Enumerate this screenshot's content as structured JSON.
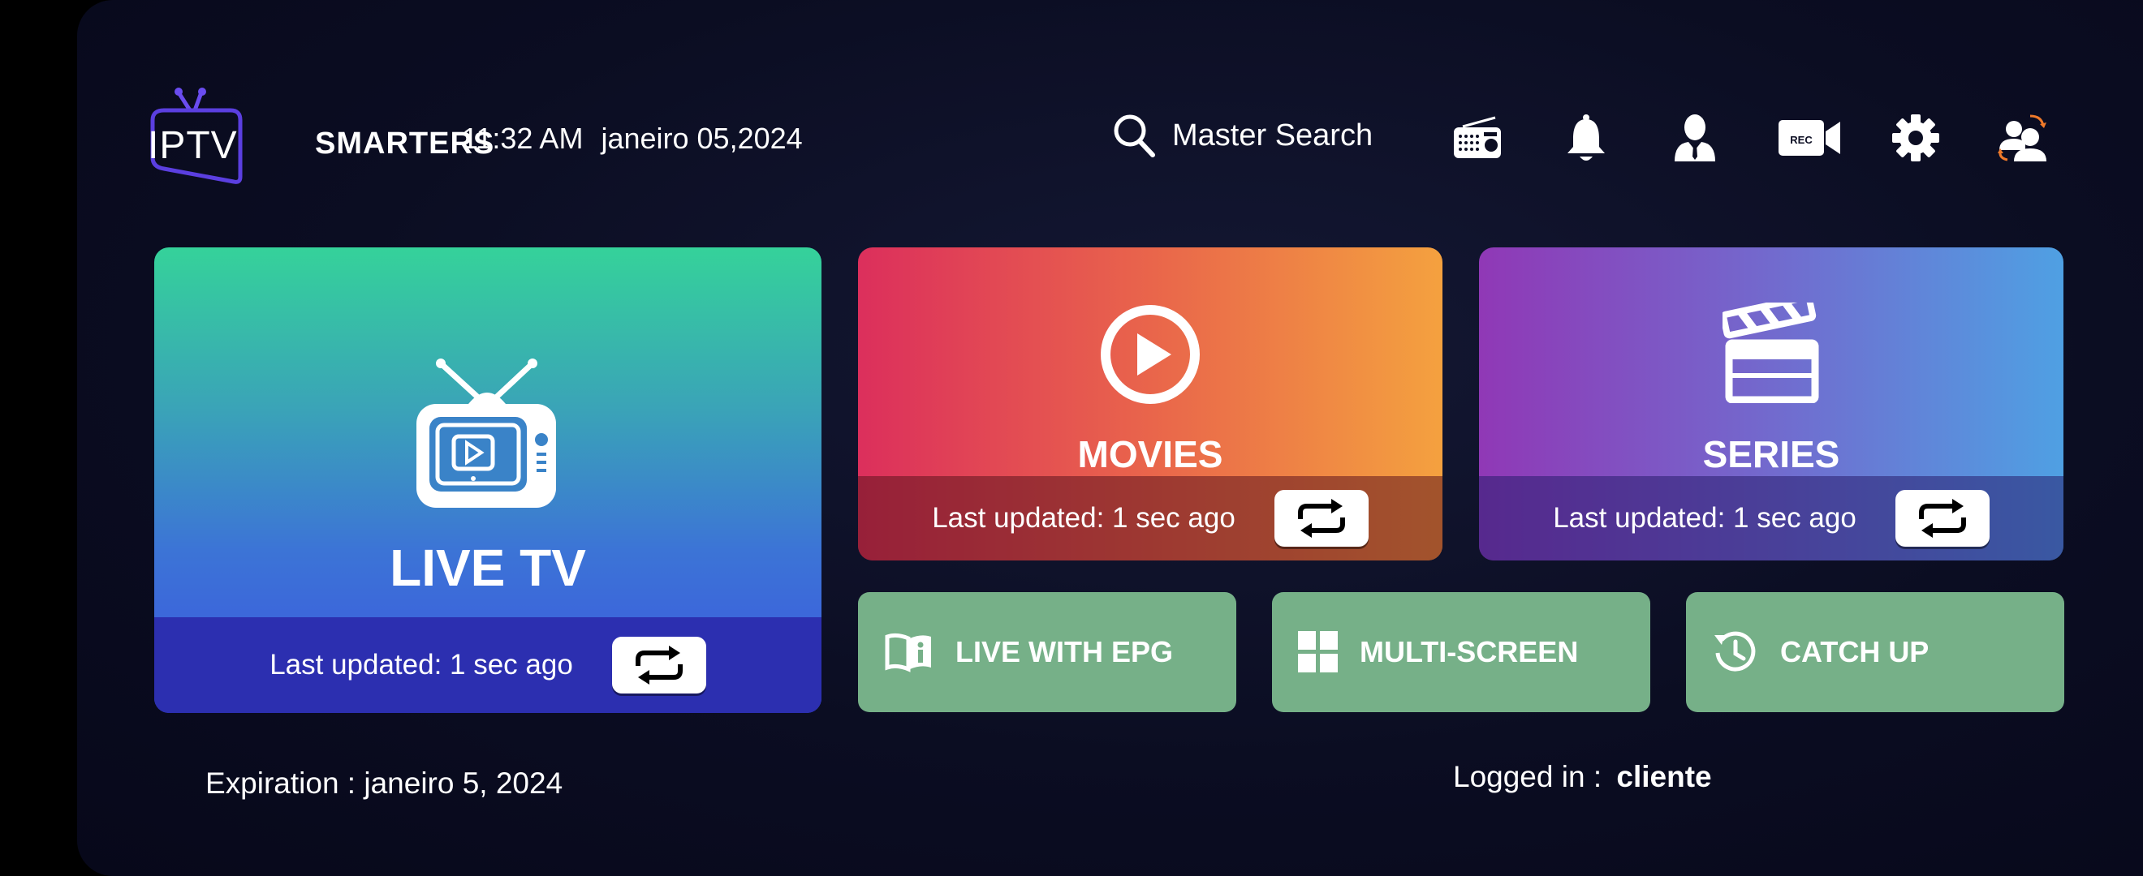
{
  "header": {
    "logo_left": "IPTV",
    "logo_right": "SMARTERS",
    "time": "11:32 AM",
    "date": "janeiro 05,2024",
    "search_label": "Master Search",
    "icons": [
      "radio-icon",
      "bell-icon",
      "user-icon",
      "rec-camera-icon",
      "gear-icon",
      "switch-user-icon"
    ],
    "rec_label": "REC"
  },
  "tiles": {
    "live_tv": {
      "title": "LIVE TV",
      "updated": "Last updated: 1 sec ago"
    },
    "movies": {
      "title": "MOVIES",
      "updated": "Last updated: 1 sec ago"
    },
    "series": {
      "title": "SERIES",
      "updated": "Last updated: 1 sec ago"
    },
    "live_epg": {
      "label": "LIVE WITH EPG"
    },
    "multi_screen": {
      "label": "MULTI-SCREEN"
    },
    "catch_up": {
      "label": "CATCH UP"
    }
  },
  "footer": {
    "expiration": "Expiration : janeiro 5, 2024",
    "logged_in_label": "Logged in :",
    "username": "cliente"
  },
  "colors": {
    "accent_purple": "#5b3fe0",
    "tile_green": "#76b088",
    "background": "#0b0d22"
  }
}
